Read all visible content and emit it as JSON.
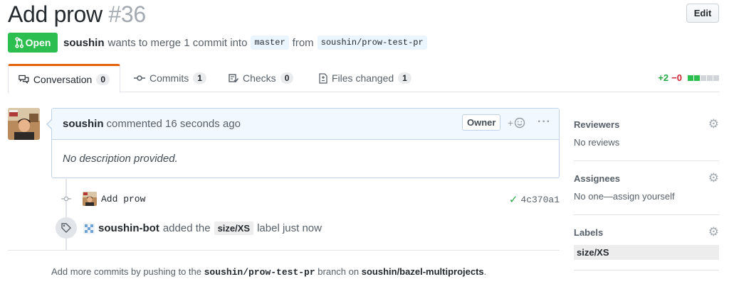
{
  "pr": {
    "title": "Add prow",
    "number": "#36",
    "edit_label": "Edit",
    "state": "Open",
    "author": "soushin",
    "merge_text": "wants to merge 1 commit into",
    "base_branch": "master",
    "from_text": "from",
    "head_branch": "soushin/prow-test-pr"
  },
  "tabs": [
    {
      "label": "Conversation",
      "count": "0",
      "icon": "comment-discussion-icon"
    },
    {
      "label": "Commits",
      "count": "1",
      "icon": "git-commit-icon"
    },
    {
      "label": "Checks",
      "count": "0",
      "icon": "checklist-icon"
    },
    {
      "label": "Files changed",
      "count": "1",
      "icon": "file-diff-icon"
    }
  ],
  "diffstat": {
    "additions": "+2",
    "deletions": "−0",
    "add_color": "#2cbe4e",
    "neutral_color": "#d1d5da"
  },
  "comment": {
    "author": "soushin",
    "action": "commented 16 seconds ago",
    "badge": "Owner",
    "body": "No description provided."
  },
  "commit": {
    "message": "Add prow",
    "sha": "4c370a1"
  },
  "label_event": {
    "actor": "soushin-bot",
    "text_before": "added the",
    "label": "size/XS",
    "text_after": "label just now"
  },
  "footer": {
    "prefix": "Add more commits by pushing to the",
    "branch": "soushin/prow-test-pr",
    "middle": "branch on",
    "repo": "soushin/bazel-multiprojects",
    "suffix": "."
  },
  "sidebar": {
    "reviewers": {
      "title": "Reviewers",
      "value": "No reviews"
    },
    "assignees": {
      "title": "Assignees",
      "value": "No one—assign yourself"
    },
    "labels": {
      "title": "Labels",
      "value": "size/XS"
    }
  }
}
